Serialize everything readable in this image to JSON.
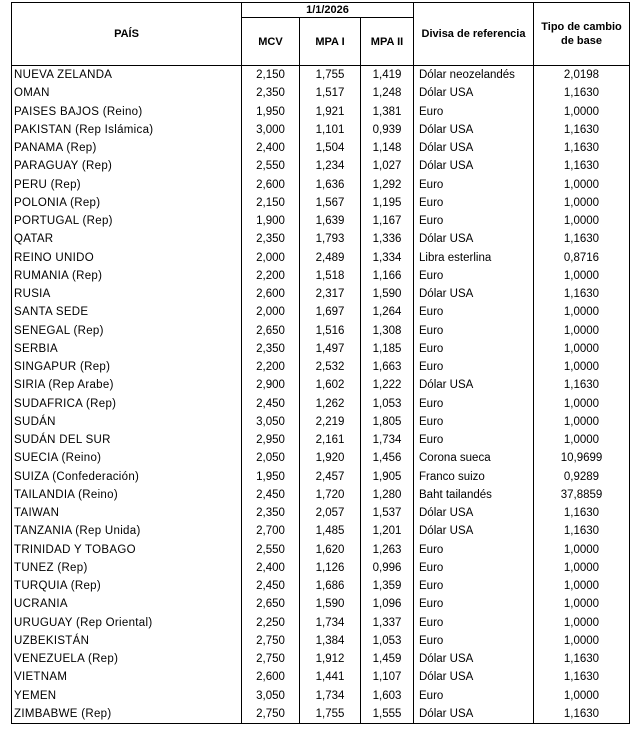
{
  "header": {
    "date": "1/1/2026",
    "pais": "PAÍS",
    "mcv": "MCV",
    "mpa1": "MPA I",
    "mpa2": "MPA II",
    "divisa": "Divisa de referencia",
    "tipo": "Tipo de cambio de base"
  },
  "rows": [
    {
      "pais": "NUEVA ZELANDA",
      "mcv": "2,150",
      "mpa1": "1,755",
      "mpa2": "1,419",
      "divisa": "Dólar neozelandés",
      "tipo": "2,0198"
    },
    {
      "pais": "OMAN",
      "mcv": "2,350",
      "mpa1": "1,517",
      "mpa2": "1,248",
      "divisa": "Dólar USA",
      "tipo": "1,1630"
    },
    {
      "pais": "PAISES BAJOS (Reino)",
      "mcv": "1,950",
      "mpa1": "1,921",
      "mpa2": "1,381",
      "divisa": "Euro",
      "tipo": "1,0000"
    },
    {
      "pais": "PAKISTAN (Rep Islámica)",
      "mcv": "3,000",
      "mpa1": "1,101",
      "mpa2": "0,939",
      "divisa": "Dólar USA",
      "tipo": "1,1630"
    },
    {
      "pais": "PANAMA (Rep)",
      "mcv": "2,400",
      "mpa1": "1,504",
      "mpa2": "1,148",
      "divisa": "Dólar USA",
      "tipo": "1,1630"
    },
    {
      "pais": "PARAGUAY (Rep)",
      "mcv": "2,550",
      "mpa1": "1,234",
      "mpa2": "1,027",
      "divisa": "Dólar USA",
      "tipo": "1,1630"
    },
    {
      "pais": "PERU (Rep)",
      "mcv": "2,600",
      "mpa1": "1,636",
      "mpa2": "1,292",
      "divisa": "Euro",
      "tipo": "1,0000"
    },
    {
      "pais": "POLONIA (Rep)",
      "mcv": "2,150",
      "mpa1": "1,567",
      "mpa2": "1,195",
      "divisa": "Euro",
      "tipo": "1,0000"
    },
    {
      "pais": "PORTUGAL (Rep)",
      "mcv": "1,900",
      "mpa1": "1,639",
      "mpa2": "1,167",
      "divisa": "Euro",
      "tipo": "1,0000"
    },
    {
      "pais": "QATAR",
      "mcv": "2,350",
      "mpa1": "1,793",
      "mpa2": "1,336",
      "divisa": "Dólar USA",
      "tipo": "1,1630"
    },
    {
      "pais": "REINO UNIDO",
      "mcv": "2,000",
      "mpa1": "2,489",
      "mpa2": "1,334",
      "divisa": "Libra esterlina",
      "tipo": "0,8716"
    },
    {
      "pais": "RUMANIA (Rep)",
      "mcv": "2,200",
      "mpa1": "1,518",
      "mpa2": "1,166",
      "divisa": "Euro",
      "tipo": "1,0000"
    },
    {
      "pais": "RUSIA",
      "mcv": "2,600",
      "mpa1": "2,317",
      "mpa2": "1,590",
      "divisa": "Dólar USA",
      "tipo": "1,1630"
    },
    {
      "pais": "SANTA SEDE",
      "mcv": "2,000",
      "mpa1": "1,697",
      "mpa2": "1,264",
      "divisa": "Euro",
      "tipo": "1,0000"
    },
    {
      "pais": "SENEGAL (Rep)",
      "mcv": "2,650",
      "mpa1": "1,516",
      "mpa2": "1,308",
      "divisa": "Euro",
      "tipo": "1,0000"
    },
    {
      "pais": "SERBIA",
      "mcv": "2,350",
      "mpa1": "1,497",
      "mpa2": "1,185",
      "divisa": "Euro",
      "tipo": "1,0000"
    },
    {
      "pais": "SINGAPUR (Rep)",
      "mcv": "2,200",
      "mpa1": "2,532",
      "mpa2": "1,663",
      "divisa": "Euro",
      "tipo": "1,0000"
    },
    {
      "pais": "SIRIA (Rep Arabe)",
      "mcv": "2,900",
      "mpa1": "1,602",
      "mpa2": "1,222",
      "divisa": "Dólar USA",
      "tipo": "1,1630"
    },
    {
      "pais": "SUDAFRICA (Rep)",
      "mcv": "2,450",
      "mpa1": "1,262",
      "mpa2": "1,053",
      "divisa": "Euro",
      "tipo": "1,0000"
    },
    {
      "pais": "SUDÁN",
      "mcv": "3,050",
      "mpa1": "2,219",
      "mpa2": "1,805",
      "divisa": "Euro",
      "tipo": "1,0000"
    },
    {
      "pais": "SUDÁN DEL SUR",
      "mcv": "2,950",
      "mpa1": "2,161",
      "mpa2": "1,734",
      "divisa": "Euro",
      "tipo": "1,0000"
    },
    {
      "pais": "SUECIA (Reino)",
      "mcv": "2,050",
      "mpa1": "1,920",
      "mpa2": "1,456",
      "divisa": "Corona sueca",
      "tipo": "10,9699"
    },
    {
      "pais": "SUIZA (Confederación)",
      "mcv": "1,950",
      "mpa1": "2,457",
      "mpa2": "1,905",
      "divisa": "Franco suizo",
      "tipo": "0,9289"
    },
    {
      "pais": "TAILANDIA (Reino)",
      "mcv": "2,450",
      "mpa1": "1,720",
      "mpa2": "1,280",
      "divisa": "Baht tailandés",
      "tipo": "37,8859"
    },
    {
      "pais": "TAIWAN",
      "mcv": "2,350",
      "mpa1": "2,057",
      "mpa2": "1,537",
      "divisa": "Dólar USA",
      "tipo": "1,1630"
    },
    {
      "pais": "TANZANIA (Rep Unida)",
      "mcv": "2,700",
      "mpa1": "1,485",
      "mpa2": "1,201",
      "divisa": "Dólar USA",
      "tipo": "1,1630"
    },
    {
      "pais": "TRINIDAD Y TOBAGO",
      "mcv": "2,550",
      "mpa1": "1,620",
      "mpa2": "1,263",
      "divisa": "Euro",
      "tipo": "1,0000"
    },
    {
      "pais": "TUNEZ (Rep)",
      "mcv": "2,400",
      "mpa1": "1,126",
      "mpa2": "0,996",
      "divisa": "Euro",
      "tipo": "1,0000"
    },
    {
      "pais": "TURQUIA (Rep)",
      "mcv": "2,450",
      "mpa1": "1,686",
      "mpa2": "1,359",
      "divisa": "Euro",
      "tipo": "1,0000"
    },
    {
      "pais": "UCRANIA",
      "mcv": "2,650",
      "mpa1": "1,590",
      "mpa2": "1,096",
      "divisa": "Euro",
      "tipo": "1,0000"
    },
    {
      "pais": "URUGUAY (Rep Oriental)",
      "mcv": "2,250",
      "mpa1": "1,734",
      "mpa2": "1,337",
      "divisa": "Euro",
      "tipo": "1,0000"
    },
    {
      "pais": "UZBEKISTÁN",
      "mcv": "2,750",
      "mpa1": "1,384",
      "mpa2": "1,053",
      "divisa": "Euro",
      "tipo": "1,0000"
    },
    {
      "pais": "VENEZUELA (Rep)",
      "mcv": "2,750",
      "mpa1": "1,912",
      "mpa2": "1,459",
      "divisa": "Dólar USA",
      "tipo": "1,1630"
    },
    {
      "pais": "VIETNAM",
      "mcv": "2,600",
      "mpa1": "1,441",
      "mpa2": "1,107",
      "divisa": "Dólar USA",
      "tipo": "1,1630"
    },
    {
      "pais": "YEMEN",
      "mcv": "3,050",
      "mpa1": "1,734",
      "mpa2": "1,603",
      "divisa": "Euro",
      "tipo": "1,0000"
    },
    {
      "pais": "ZIMBABWE (Rep)",
      "mcv": "2,750",
      "mpa1": "1,755",
      "mpa2": "1,555",
      "divisa": "Dólar USA",
      "tipo": "1,1630"
    }
  ]
}
